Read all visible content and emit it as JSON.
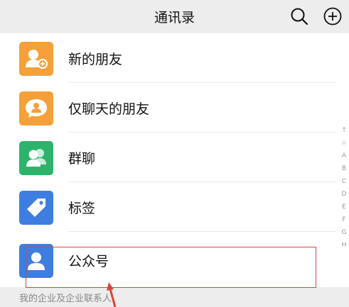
{
  "header": {
    "title": "通讯录",
    "search_icon": "search-icon",
    "add_icon": "plus-circle-icon"
  },
  "items": [
    {
      "label": "新的朋友",
      "icon": "add-friend-icon",
      "color": "#F5A03A"
    },
    {
      "label": "仅聊天的朋友",
      "icon": "chat-only-friend-icon",
      "color": "#F5A03A"
    },
    {
      "label": "群聊",
      "icon": "group-chat-icon",
      "color": "#2DB46A"
    },
    {
      "label": "标签",
      "icon": "tag-icon",
      "color": "#3E7EE0"
    },
    {
      "label": "公众号",
      "icon": "official-account-icon",
      "color": "#3E7EE0"
    }
  ],
  "section_footer": "我的企业及企业联系人",
  "side_index": [
    "↑",
    "☆",
    "A",
    "B",
    "C",
    "D",
    "E",
    "F",
    "G",
    "H"
  ],
  "annotation": {
    "highlight_color": "#D9443A"
  }
}
